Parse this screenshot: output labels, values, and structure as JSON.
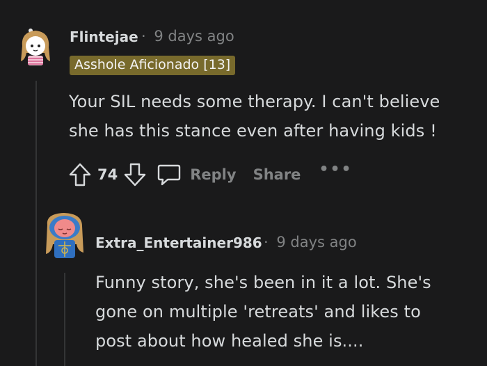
{
  "comment": {
    "username": "Flintejae",
    "separator": "·",
    "timestamp": "9 days ago",
    "flair": "Asshole Aficionado [13]",
    "body": "Your SIL needs some therapy. I can't believe\nshe has this stance even after having kids !",
    "score": "74",
    "reply_label": "Reply",
    "share_label": "Share",
    "more_label": "•••",
    "flair_color": "#786a2c"
  },
  "reply": {
    "username": "Extra_Entertainer986",
    "separator": "·",
    "timestamp": "9 days ago",
    "body": "Funny story, she's been in it a lot. She's\ngone on multiple 'retreats' and likes to\npost about how healed she is...."
  },
  "icons": {
    "upvote": "upvote-arrow-icon",
    "downvote": "downvote-arrow-icon",
    "reply": "speech-bubble-icon"
  }
}
